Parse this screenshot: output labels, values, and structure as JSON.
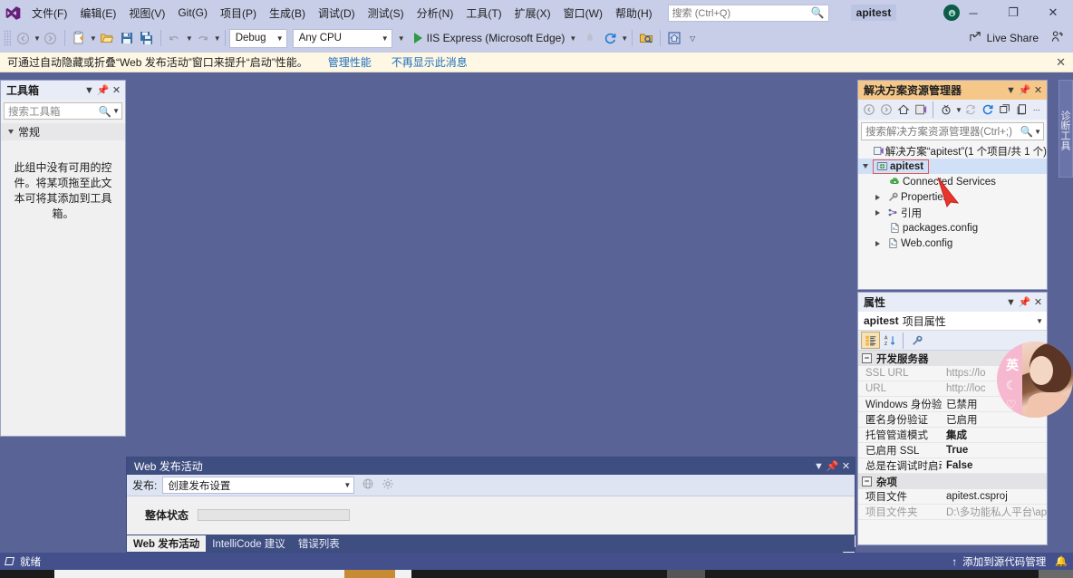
{
  "window": {
    "project_chip": "apitest",
    "minimize": "─",
    "maximize": "❐",
    "close": "✕"
  },
  "menu": {
    "items": [
      {
        "label": "文件(F)"
      },
      {
        "label": "编辑(E)"
      },
      {
        "label": "视图(V)"
      },
      {
        "label": "Git(G)"
      },
      {
        "label": "项目(P)"
      },
      {
        "label": "生成(B)"
      },
      {
        "label": "调试(D)"
      },
      {
        "label": "测试(S)"
      },
      {
        "label": "分析(N)"
      },
      {
        "label": "工具(T)"
      },
      {
        "label": "扩展(X)"
      },
      {
        "label": "窗口(W)"
      },
      {
        "label": "帮助(H)"
      }
    ],
    "quick_search_placeholder": "搜索 (Ctrl+Q)"
  },
  "toolbar": {
    "config": "Debug",
    "platform": "Any CPU",
    "run_label": "IIS Express (Microsoft Edge)",
    "live_share": "Live Share"
  },
  "infobar": {
    "message": "可通过自动隐藏或折叠“Web 发布活动”窗口来提升“启动”性能。",
    "link1": "管理性能",
    "link2": "不再显示此消息",
    "close": "✕"
  },
  "toolbox": {
    "title": "工具箱",
    "search_placeholder": "搜索工具箱",
    "group": "常规",
    "empty_text": "此组中没有可用的控件。将某项拖至此文本可将其添加到工具箱。"
  },
  "solution_explorer": {
    "title": "解决方案资源管理器",
    "search_placeholder": "搜索解决方案资源管理器(Ctrl+;)",
    "tree": [
      {
        "label": "解决方案“apitest”(1 个项目/共 1 个)",
        "icon": "solution-icon",
        "indent": 0,
        "expander": "none",
        "selected": false,
        "highlight": false
      },
      {
        "label": "apitest",
        "icon": "project-icon",
        "indent": 0,
        "expander": "down",
        "selected": true,
        "highlight": true
      },
      {
        "label": "Connected Services",
        "icon": "services-icon",
        "indent": 2,
        "expander": "none",
        "selected": false,
        "highlight": false
      },
      {
        "label": "Properties",
        "icon": "wrench-icon",
        "indent": 1,
        "expander": "right",
        "selected": false,
        "highlight": false
      },
      {
        "label": "引用",
        "icon": "reference-icon",
        "indent": 1,
        "expander": "right",
        "selected": false,
        "highlight": false
      },
      {
        "label": "packages.config",
        "icon": "config-icon",
        "indent": 2,
        "expander": "none",
        "selected": false,
        "highlight": false
      },
      {
        "label": "Web.config",
        "icon": "config-icon",
        "indent": 1,
        "expander": "right",
        "selected": false,
        "highlight": false
      }
    ]
  },
  "properties": {
    "title": "属性",
    "object_name": "apitest",
    "object_kind": "项目属性",
    "rows": [
      {
        "type": "category",
        "label": "开发服务器",
        "sign": "−"
      },
      {
        "type": "row",
        "key": "SSL URL",
        "value": "https://lo",
        "dim": true,
        "bold": false
      },
      {
        "type": "row",
        "key": "URL",
        "value": "http://loc",
        "dim": true,
        "bold": false
      },
      {
        "type": "row",
        "key": "Windows 身份验证",
        "value": "已禁用",
        "dim": false,
        "bold": false
      },
      {
        "type": "row",
        "key": "匿名身份验证",
        "value": "已启用",
        "dim": false,
        "bold": false
      },
      {
        "type": "row",
        "key": "托管管道模式",
        "value": "集成",
        "dim": false,
        "bold": true
      },
      {
        "type": "row",
        "key": "已启用 SSL",
        "value": "True",
        "dim": false,
        "bold": true
      },
      {
        "type": "row",
        "key": "总是在调试时启动",
        "value": "False",
        "dim": false,
        "bold": true
      },
      {
        "type": "category",
        "label": "杂项",
        "sign": "−"
      },
      {
        "type": "row",
        "key": "项目文件",
        "value": "apitest.csproj",
        "dim": false,
        "bold": false
      },
      {
        "type": "row",
        "key": "项目文件夹",
        "value": "D:\\多功能私人平台\\ap",
        "dim": true,
        "bold": false
      }
    ]
  },
  "web_publish": {
    "title": "Web 发布活动",
    "publish_label": "发布:",
    "publish_value": "创建发布设置",
    "overall_status_label": "整体状态",
    "tabs": [
      {
        "label": "Web 发布活动",
        "selected": true
      },
      {
        "label": "IntelliCode 建议",
        "selected": false
      },
      {
        "label": "错误列表",
        "selected": false
      }
    ]
  },
  "diagnostics_tab": {
    "label": "诊断工具"
  },
  "avatar_widget": {
    "text": "英",
    "moon": "☾",
    "heart": "♡"
  },
  "statusbar": {
    "ready": "就绪",
    "source_control": "添加到源代码管理",
    "up_arrow": "↑"
  },
  "colors": {
    "chrome": "#c8cee8",
    "workarea": "#5a6396",
    "statusbar": "#44508c",
    "accent_panel_head": "#f5c88a",
    "infobar": "#fdf7e3",
    "link": "#1f6fbf",
    "highlight_box": "#e05a5a",
    "selection": "#cfe0f7"
  }
}
